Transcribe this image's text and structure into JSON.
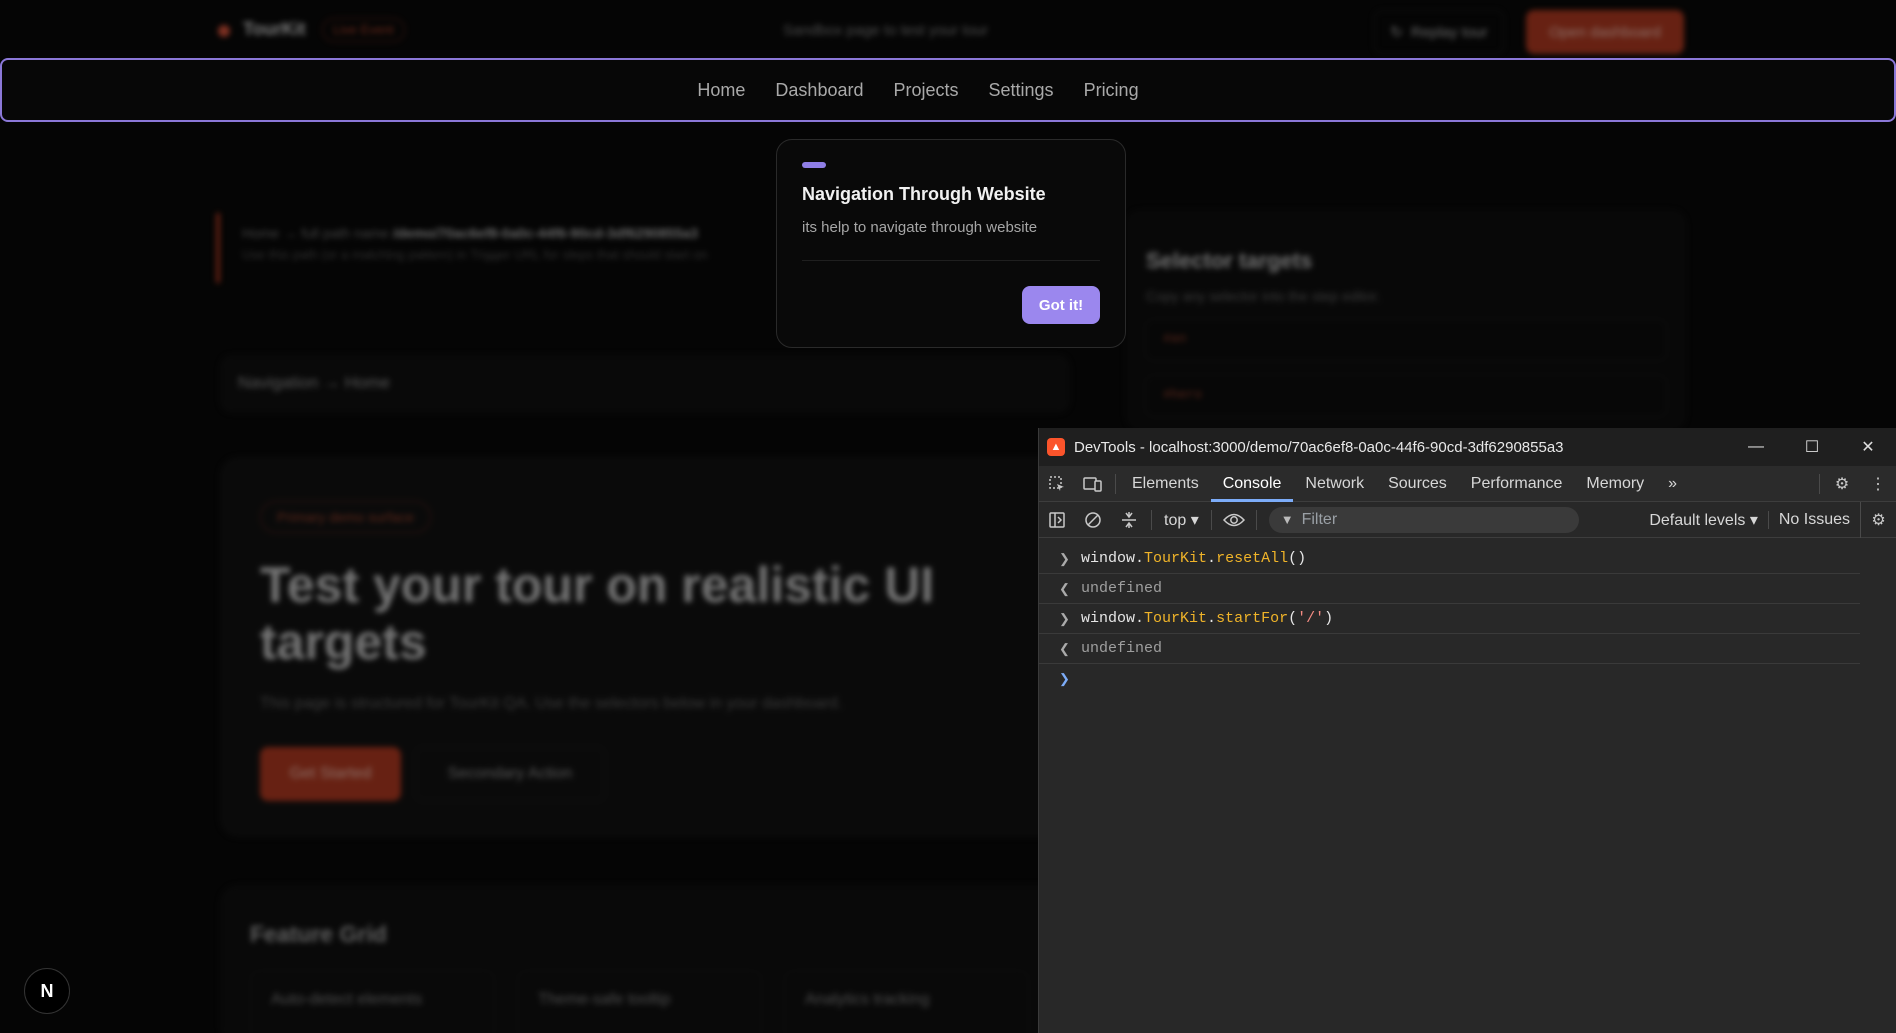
{
  "background": {
    "brand": "TourKit",
    "live_badge": "Live Event",
    "header_subtitle": "Sandbox page to test your tour",
    "replay_label": "Replay tour",
    "open_dashboard_label": "Open dashboard",
    "breadcrumb": {
      "home": "Home",
      "sep": "→",
      "label": "full path name",
      "path": "/demo/70ac6ef8-0a0c-44f6-90cd-3df6290855a3",
      "hint": "Use this path (or a matching pattern) in Trigger URL for steps that should start on"
    },
    "nav_status": "Navigation → Home",
    "selector": {
      "title": "Selector targets",
      "subtitle": "Copy any selector into the step editor.",
      "rows": [
        "#an",
        "#hero"
      ]
    },
    "hero": {
      "chip": "Primary demo surface",
      "title": "Test your tour on realistic UI targets",
      "description": "This page is structured for TourKit QA. Use the selectors below in your dashboard.",
      "primary_label": "Get Started",
      "secondary_label": "Secondary Action"
    },
    "features": {
      "title": "Feature Grid",
      "items": [
        "Auto-detect elements",
        "Theme-safe tooltip",
        "Analytics tracking"
      ]
    }
  },
  "nav": {
    "items": [
      "Home",
      "Dashboard",
      "Projects",
      "Settings",
      "Pricing"
    ]
  },
  "tour": {
    "title": "Navigation Through Website",
    "body": "its help to navigate through website",
    "button_label": "Got it!",
    "accent": "#9b87ee"
  },
  "next_badge": "N",
  "devtools": {
    "title": "DevTools - localhost:3000/demo/70ac6ef8-0a0c-44f6-90cd-3df6290855a3",
    "window_controls": [
      "—",
      "☐",
      "✕"
    ],
    "tabs": [
      "Elements",
      "Console",
      "Network",
      "Sources",
      "Performance",
      "Memory"
    ],
    "active_tab": "Console",
    "more_tabs": "»",
    "toolbar": {
      "context": "top ▾",
      "filter_placeholder": "Filter",
      "levels": "Default levels ▾",
      "issues": "No Issues"
    },
    "console": [
      {
        "type": "input",
        "obj": "window",
        "member": "TourKit",
        "method": "resetAll",
        "args": "()"
      },
      {
        "type": "output",
        "text": "undefined"
      },
      {
        "type": "input",
        "obj": "window",
        "member": "TourKit",
        "method": "startFor",
        "args": "'/'"
      },
      {
        "type": "output",
        "text": "undefined"
      }
    ],
    "accent": "#7cacf8"
  }
}
